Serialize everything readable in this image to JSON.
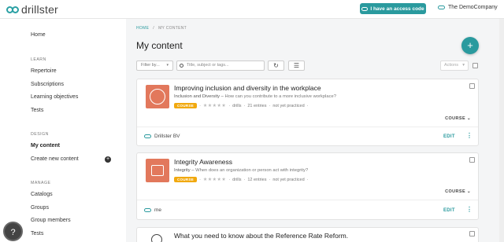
{
  "brand": {
    "name": "drillster"
  },
  "header": {
    "access_button": "I have an access code",
    "company": "The DemoCompany"
  },
  "sidebar": {
    "home": "Home",
    "learn_heading": "LEARN",
    "learn": [
      "Repertoire",
      "Subscriptions",
      "Learning objectives",
      "Tests"
    ],
    "design_heading": "DESIGN",
    "design": [
      "My content",
      "Create new content"
    ],
    "manage_heading": "MANAGE",
    "manage": [
      "Catalogs",
      "Groups",
      "Group members",
      "Tests"
    ],
    "help": "?"
  },
  "breadcrumb": {
    "home": "HOME",
    "separator": "/",
    "current": "MY CONTENT"
  },
  "page_title": "My content",
  "toolbar": {
    "fab": "+",
    "filter_label": "Filter by...",
    "search_placeholder": "Title, subject or tags...",
    "actions_label": "Actions"
  },
  "cards": [
    {
      "title": "Improving inclusion and diversity in the workplace",
      "subject": "Inclusion and Diversity",
      "question": "How can you contribute to a more inclusive workplace?",
      "badge": "COURSE",
      "stars": "★★★★★",
      "drills": "drills",
      "entries": "21 entries",
      "status": "not yet practiced",
      "toggle": "COURSE",
      "owner": "Drillster BV",
      "edit": "EDIT"
    },
    {
      "title": "Integrity Awareness",
      "subject": "Integrity",
      "question": "When does an organization or person act with integrity?",
      "badge": "COURSE",
      "stars": "★★★★★",
      "drills": "drills",
      "entries": "12 entries",
      "status": "not yet practiced",
      "toggle": "COURSE",
      "owner": "me",
      "edit": "EDIT"
    },
    {
      "title": "What you need to know about the Reference Rate Reform."
    }
  ]
}
